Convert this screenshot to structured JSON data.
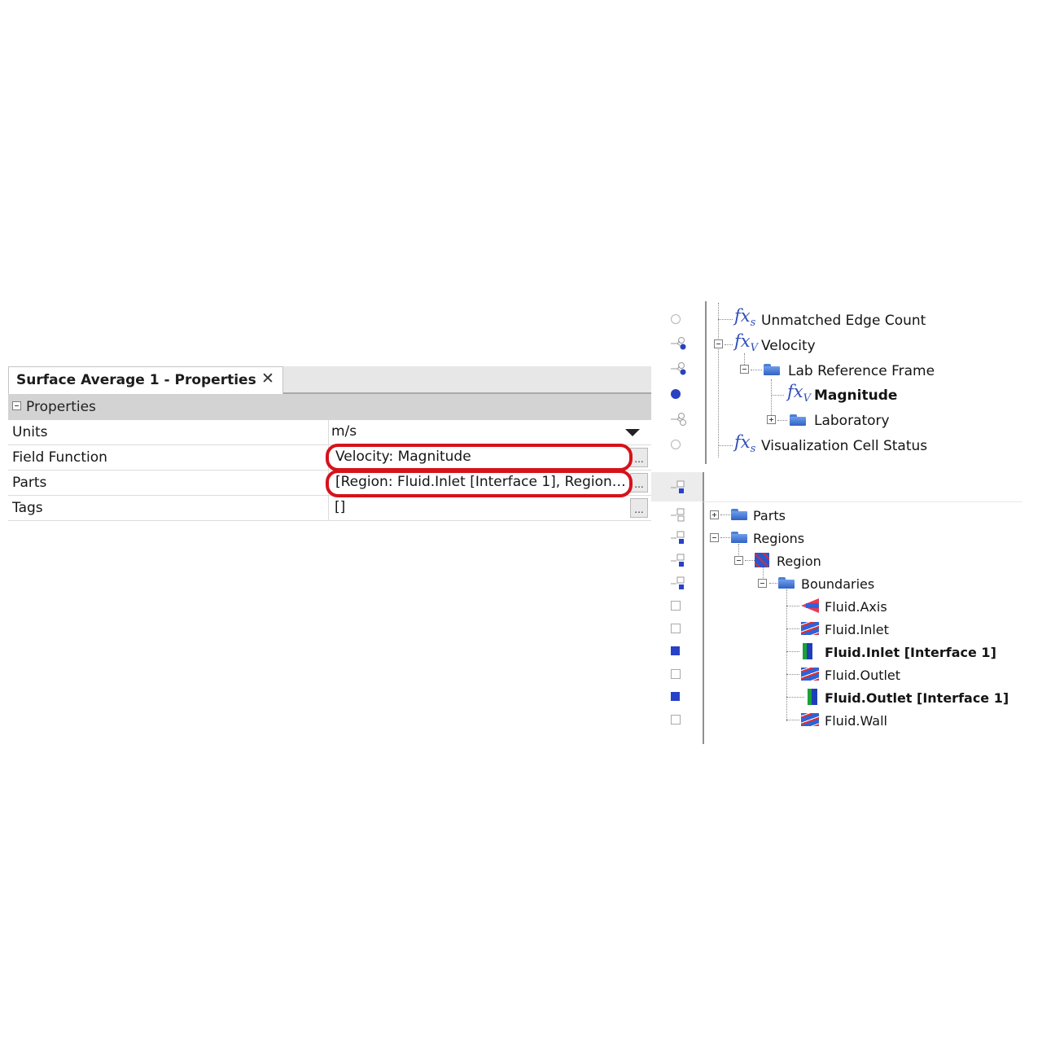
{
  "properties_panel": {
    "tab_title": "Surface Average 1 - Properties",
    "close_glyph": "✕",
    "group_label": "Properties",
    "rows": [
      {
        "key": "Units",
        "value": "m/s",
        "control": "dropdown"
      },
      {
        "key": "Field Function",
        "value": "Velocity: Magnitude",
        "control": "ellipsis",
        "highlighted": true
      },
      {
        "key": "Parts",
        "value": "[Region: Fluid.Inlet [Interface 1], Region: F...",
        "control": "ellipsis",
        "highlighted": true
      },
      {
        "key": "Tags",
        "value": "[]",
        "control": "ellipsis"
      }
    ],
    "ellipsis_label": "...",
    "highlight_color": "#d6121b"
  },
  "field_function_tree": {
    "fx_glyph": "fx",
    "items": [
      {
        "label": "Unmatched Edge Count",
        "subscript": "s",
        "status": "empty-circle"
      },
      {
        "label": "Velocity",
        "subscript": "V",
        "status": "share-node",
        "expanded": true
      },
      {
        "label": "Lab Reference Frame",
        "icon": "folder-icon",
        "status": "share-node",
        "expanded": true
      },
      {
        "label": "Magnitude",
        "subscript": "V",
        "status": "filled-circle",
        "selected": true
      },
      {
        "label": "Laboratory",
        "icon": "folder-icon",
        "status": "share-node",
        "expanded": false
      },
      {
        "label": "Visualization Cell Status",
        "subscript": "s",
        "status": "empty-circle"
      }
    ]
  },
  "parts_tree": {
    "items": [
      {
        "label": "Parts",
        "icon": "folder-icon",
        "expanded": false
      },
      {
        "label": "Regions",
        "icon": "folder-icon",
        "expanded": true
      },
      {
        "label": "Region",
        "icon": "region-icon",
        "expanded": true
      },
      {
        "label": "Boundaries",
        "icon": "folder-icon",
        "expanded": true
      },
      {
        "label": "Fluid.Axis",
        "icon": "axis-boundary-icon",
        "selected": false
      },
      {
        "label": "Fluid.Inlet",
        "icon": "mesh-boundary-icon",
        "selected": false
      },
      {
        "label": "Fluid.Inlet [Interface 1]",
        "icon": "interface-boundary-icon",
        "selected": true
      },
      {
        "label": "Fluid.Outlet",
        "icon": "mesh-boundary-icon",
        "selected": false
      },
      {
        "label": "Fluid.Outlet [Interface 1]",
        "icon": "interface-boundary-icon",
        "selected": true
      },
      {
        "label": "Fluid.Wall",
        "icon": "mesh-boundary-icon",
        "selected": false
      }
    ]
  }
}
